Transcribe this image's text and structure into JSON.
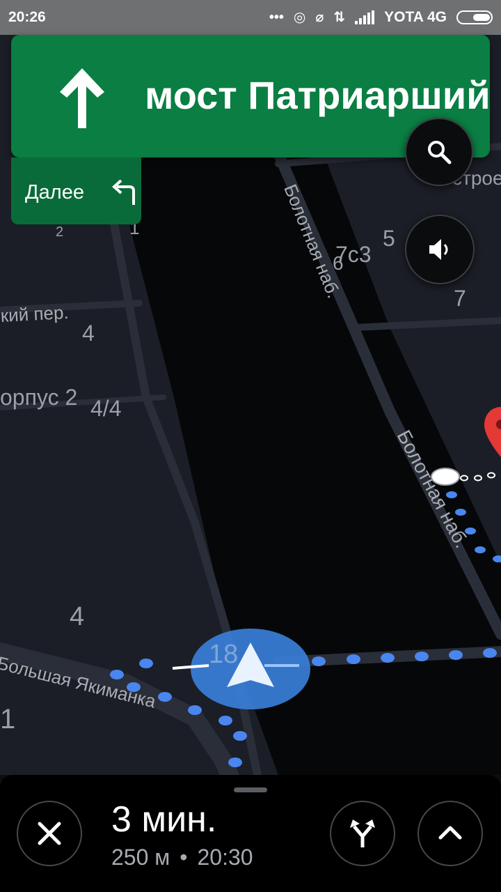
{
  "status_bar": {
    "time": "20:26",
    "carrier": "YOTA 4G",
    "icons": [
      "more-icon",
      "hotspot-icon",
      "vibrate-off-icon",
      "data-arrows-icon",
      "signal-icon",
      "battery-icon"
    ]
  },
  "navigation": {
    "direction": "straight-arrow-icon",
    "street": "мост Патриарший",
    "next_label": "Далее",
    "next_direction": "turn-left-icon",
    "banner_color": "#0a7e43"
  },
  "map": {
    "labels": [
      "2",
      "1",
      "5",
      "7с3",
      "6",
      "7",
      "4",
      "4/4",
      "4",
      "18",
      "1"
    ],
    "partial_labels": [
      "строе",
      "орпус 2"
    ],
    "streets": [
      "Болотная наб.",
      "Болотная наб.",
      "кий пер.",
      "Большая Якиманка"
    ],
    "route_color": "#4a86f0",
    "destination_pin_color": "#e53935"
  },
  "map_controls": {
    "search_icon": "search-icon",
    "sound_icon": "volume-icon"
  },
  "bottom_sheet": {
    "duration": "3 мин.",
    "distance": "250 м",
    "separator": "•",
    "arrival": "20:30",
    "close_icon": "close-icon",
    "routes_icon": "alt-routes-icon",
    "expand_icon": "chevron-up-icon"
  }
}
